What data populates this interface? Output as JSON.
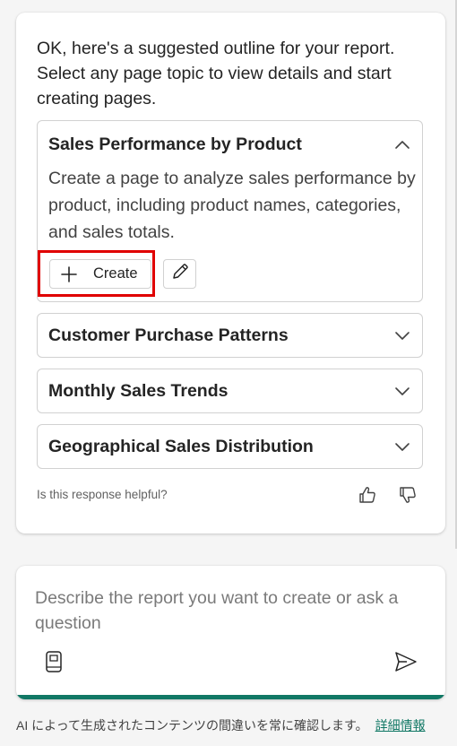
{
  "response": {
    "intro": "OK, here's a suggested outline for your report. Select any page topic to view details and start creating pages.",
    "topics": [
      {
        "title": "Sales Performance by Product",
        "expanded": true,
        "description": "Create a page to analyze sales performance by product, including product names, categories, and sales totals.",
        "create_label": "Create"
      },
      {
        "title": "Customer Purchase Patterns",
        "expanded": false
      },
      {
        "title": "Monthly Sales Trends",
        "expanded": false
      },
      {
        "title": "Geographical Sales Distribution",
        "expanded": false
      }
    ],
    "feedback_prompt": "Is this response helpful?"
  },
  "composer": {
    "placeholder": "Describe the report you want to create or ask a question"
  },
  "footer": {
    "disclaimer": "AI によって生成されたコンテンツの間違いを常に確認します。",
    "link": "詳細情報"
  },
  "colors": {
    "accent": "#117865",
    "highlight": "#e00000"
  }
}
